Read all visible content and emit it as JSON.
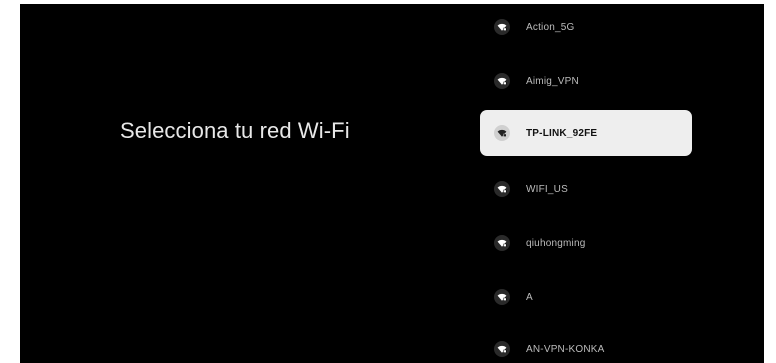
{
  "title": "Selecciona tu red Wi-Fi",
  "colors": {
    "background": "#000000",
    "selected_background": "#eeeeee",
    "text": "#e8e8e8",
    "ssid_text": "#bcbcbc"
  },
  "networks": [
    {
      "ssid": "Action_5G",
      "icon": "wifi-lock-icon",
      "selected": false
    },
    {
      "ssid": "Aimig_VPN",
      "icon": "wifi-lock-icon",
      "selected": false
    },
    {
      "ssid": "TP-LINK_92FE",
      "icon": "wifi-lock-icon",
      "selected": true
    },
    {
      "ssid": "WIFI_US",
      "icon": "wifi-lock-icon",
      "selected": false
    },
    {
      "ssid": "qiuhongming",
      "icon": "wifi-lock-icon",
      "selected": false
    },
    {
      "ssid": "A",
      "icon": "wifi-lock-icon",
      "selected": false
    },
    {
      "ssid": "AN-VPN-KONKA",
      "icon": "wifi-lock-icon",
      "selected": false
    }
  ]
}
